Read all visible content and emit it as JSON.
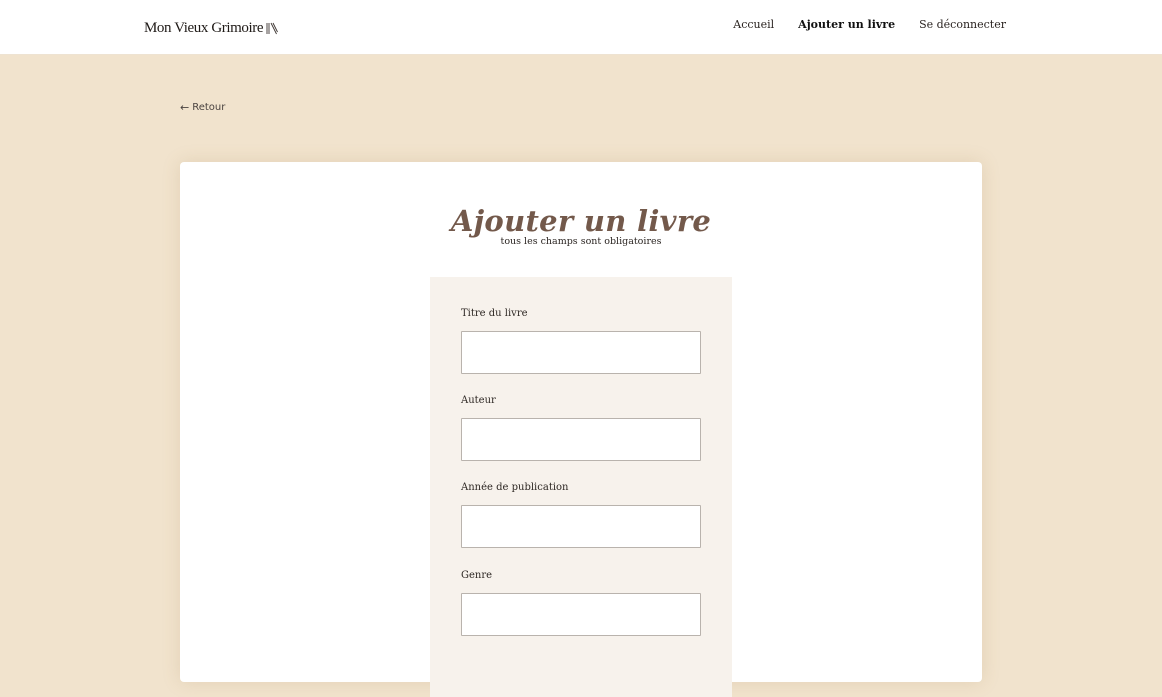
{
  "header": {
    "brand": "Mon Vieux Grimoire",
    "brand_icon": "book-icon",
    "nav": [
      {
        "label": "Accueil",
        "active": false
      },
      {
        "label": "Ajouter un livre",
        "active": true
      },
      {
        "label": "Se déconnecter",
        "active": false
      }
    ]
  },
  "back_link": {
    "icon": "arrow-left-icon",
    "label": "Retour"
  },
  "form": {
    "title": "Ajouter un livre",
    "subtitle": "tous les champs sont obligatoires",
    "fields": [
      {
        "label": "Titre du livre",
        "value": ""
      },
      {
        "label": "Auteur",
        "value": ""
      },
      {
        "label": "Année de publication",
        "value": ""
      },
      {
        "label": "Genre",
        "value": ""
      }
    ]
  },
  "colors": {
    "page_background": "#f1e3cd",
    "title_color": "#73594b",
    "panel_background": "#f7f2ec"
  }
}
